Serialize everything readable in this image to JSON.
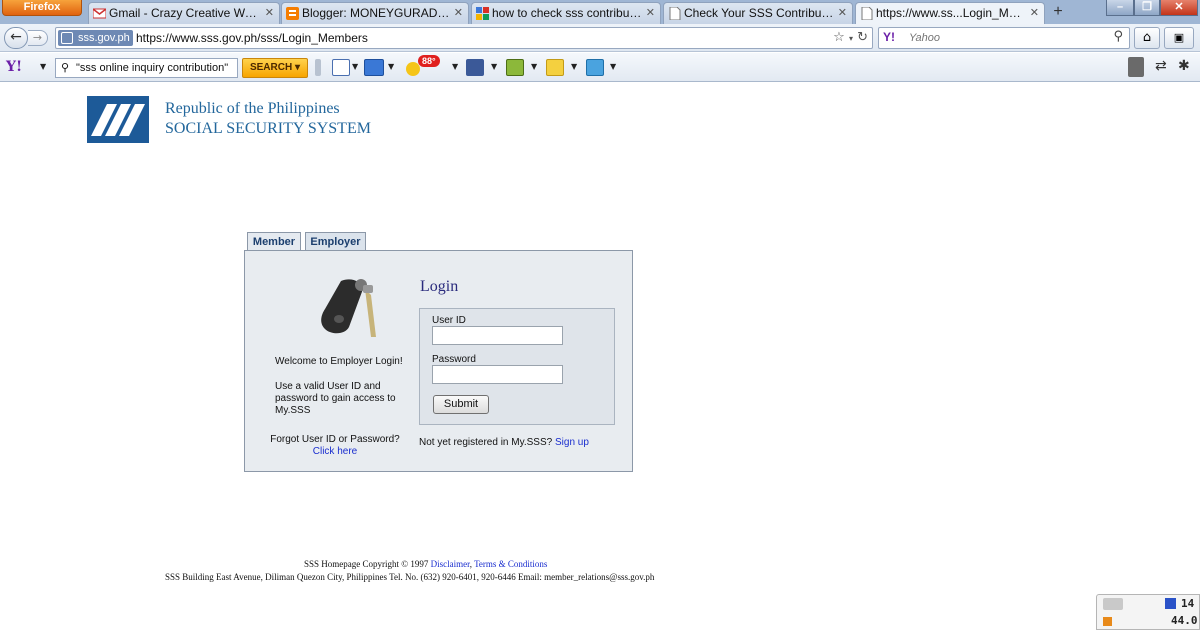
{
  "browser": {
    "app_button": "Firefox",
    "tabs": [
      {
        "label": "Gmail - Crazy Creative Writing ..."
      },
      {
        "label": "Blogger: MONEYGURADO - Bu..."
      },
      {
        "label": "how to check sss contributions ..."
      },
      {
        "label": "Check Your SSS Contribution w..."
      },
      {
        "label": "https://www.ss...Login_Members"
      }
    ],
    "new_tab": "+",
    "identity": "sss.gov.ph",
    "url": "https://www.sss.gov.ph/sss/Login_Members",
    "search_placeholder": "Yahoo",
    "search_engine": "Y!"
  },
  "yahoo_toolbar": {
    "logo": "Y!",
    "search_text": "\"sss online inquiry contribution\"",
    "search_button": "SEARCH",
    "notification_badge": "88°"
  },
  "page": {
    "brand_line1": "Republic of the Philippines",
    "brand_line2": "SOCIAL SECURITY SYSTEM",
    "tabs": [
      {
        "label": "Member"
      },
      {
        "label": "Employer"
      }
    ],
    "welcome": "Welcome to Employer Login!",
    "instructions": "Use a valid User ID and password to gain access to My.SSS",
    "forgot_text": "Forgot User ID or Password?",
    "forgot_link": "Click here",
    "login_title": "Login",
    "userid_label": "User ID",
    "password_label": "Password",
    "submit_label": "Submit",
    "register_text": "Not yet registered in My.SSS?",
    "signup_link": "Sign up",
    "footer": {
      "copyright": "SSS Homepage Copyright © 1997",
      "disclaimer_link": "Disclaimer",
      "terms_link": "Terms & Conditions",
      "address": "SSS Building East Avenue, Diliman Quezon City, Philippines Tel. No. (632) 920-6401, 920-6446 Email: member_relations@sss.gov.ph"
    }
  },
  "tray": {
    "value1": "14",
    "value2": "44.0"
  }
}
